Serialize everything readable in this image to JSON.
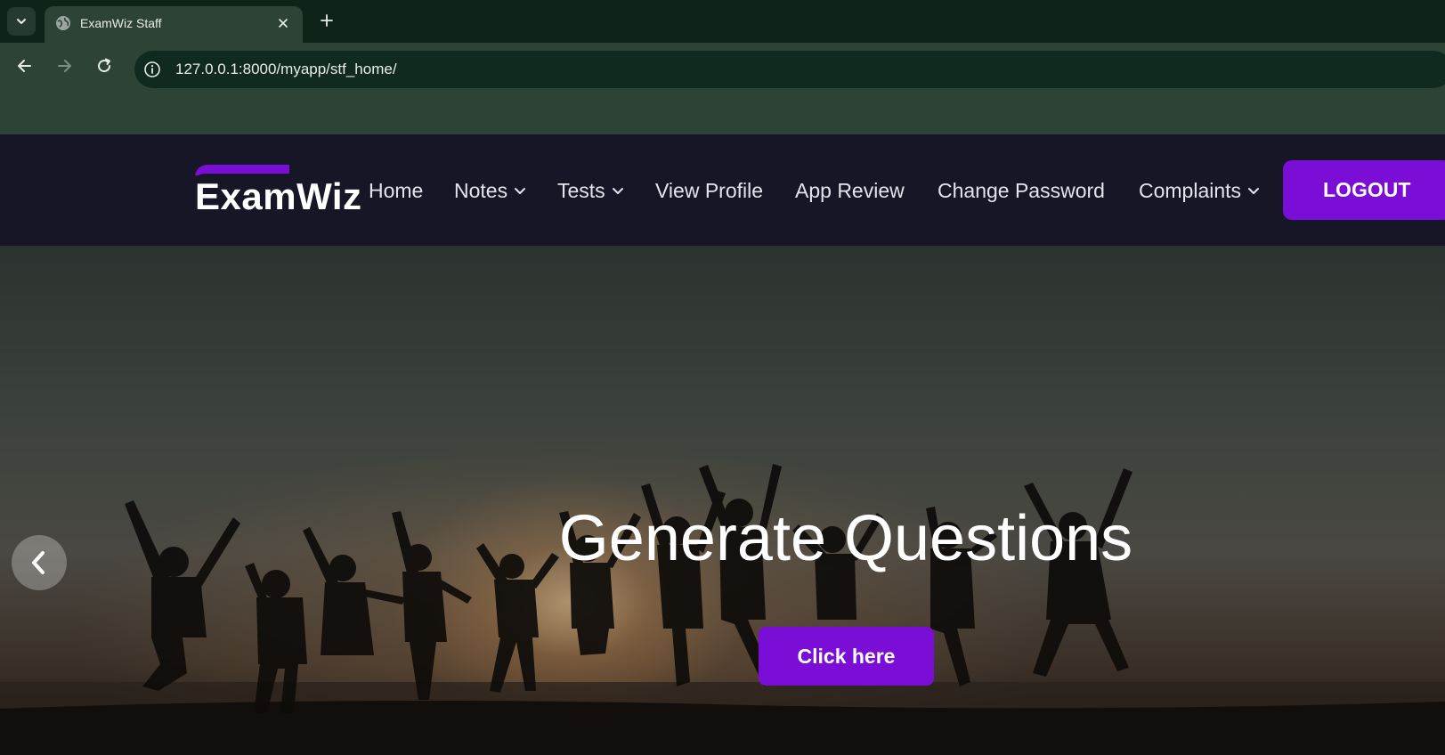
{
  "browser": {
    "tab_title": "ExamWiz Staff",
    "url": "127.0.0.1:8000/myapp/stf_home/",
    "icons": {
      "tab_list": "chevron-down-icon",
      "tab_favicon": "globe-icon",
      "tab_close": "close-icon",
      "new_tab": "plus-icon",
      "back": "arrow-left-icon",
      "forward": "arrow-right-icon",
      "reload": "reload-icon",
      "site_info": "info-icon"
    }
  },
  "site": {
    "logo_text": "ExamWiz",
    "nav": {
      "home": "Home",
      "notes": "Notes",
      "tests": "Tests",
      "view_profile": "View Profile",
      "app_review": "App Review",
      "change_password": "Change Password",
      "complaints": "Complaints"
    },
    "logout_label": "LOGOUT"
  },
  "hero": {
    "title": "Generate Questions",
    "cta_label": "Click here",
    "prev_icon": "chevron-left-icon"
  },
  "colors": {
    "accent": "#7a0ed6",
    "header_bg": "#161627",
    "browser_bg": "#0f2419",
    "browser_toolbar": "#2c4336"
  }
}
